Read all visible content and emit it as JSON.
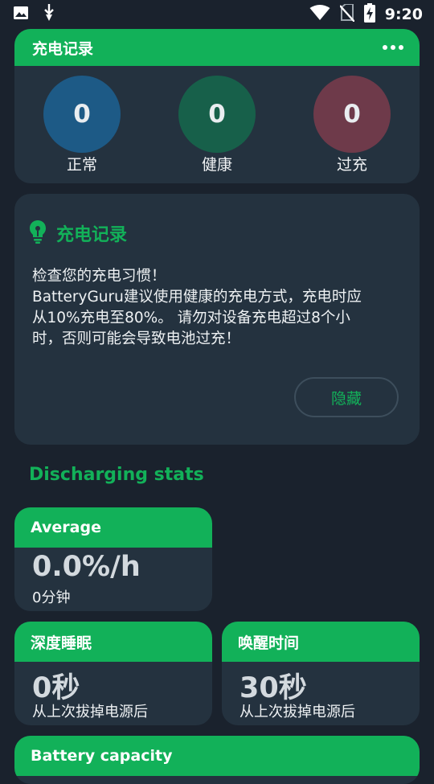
{
  "status_bar": {
    "time": "9:20",
    "icons": [
      "image-icon",
      "download-icon",
      "wifi-icon",
      "no-sim-icon",
      "battery-charging-icon"
    ]
  },
  "record_card": {
    "title": "充电记录",
    "menu_icon": "more-horizontal-icon",
    "stats": [
      {
        "value": "0",
        "label": "正常",
        "color": "#1d5a86"
      },
      {
        "value": "0",
        "label": "健康",
        "color": "#17604a"
      },
      {
        "value": "0",
        "label": "过充",
        "color": "#6e3a4a"
      }
    ]
  },
  "tip_card": {
    "icon": "lightbulb-icon",
    "title": "充电记录",
    "lines": [
      "检查您的充电习惯！",
      "BatteryGuru建议使用健康的充电方式，充电时应",
      "从10%充电至80%。 请勿对设备充电超过8个小",
      "时，否则可能会导致电池过充！"
    ],
    "hide_label": "隐藏"
  },
  "section_title": "Discharging stats",
  "average": {
    "title": "Average",
    "value": "0.0%/h",
    "sub": "0分钟"
  },
  "deep_sleep": {
    "title": "深度睡眠",
    "value": "0秒",
    "sub": "从上次拔掉电源后"
  },
  "awake": {
    "title": "唤醒时间",
    "value": "30秒",
    "sub": "从上次拔掉电源后"
  },
  "capacity": {
    "title": "Battery capacity"
  },
  "colors": {
    "accent": "#12b159",
    "background": "#1a222d",
    "card": "#24323f"
  }
}
